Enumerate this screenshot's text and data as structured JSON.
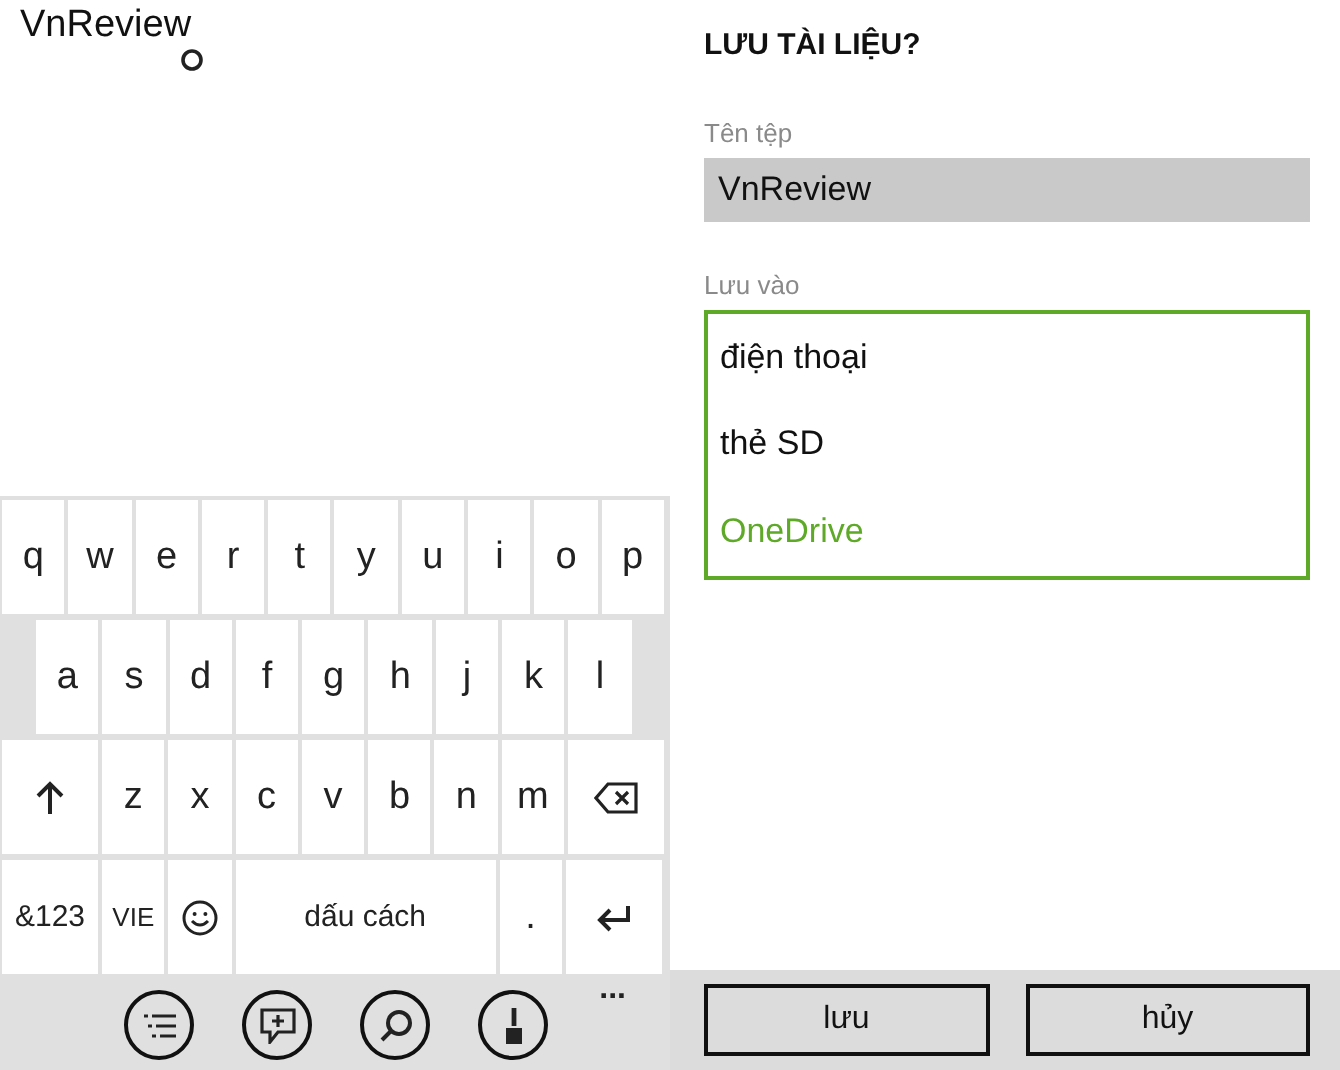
{
  "editor": {
    "text": "VnReview"
  },
  "keyboard": {
    "rows": [
      {
        "keys": [
          {
            "kind": "char",
            "label": "q"
          },
          {
            "kind": "char",
            "label": "w"
          },
          {
            "kind": "char",
            "label": "e"
          },
          {
            "kind": "char",
            "label": "r"
          },
          {
            "kind": "char",
            "label": "t"
          },
          {
            "kind": "char",
            "label": "y"
          },
          {
            "kind": "char",
            "label": "u"
          },
          {
            "kind": "char",
            "label": "i"
          },
          {
            "kind": "char",
            "label": "o"
          },
          {
            "kind": "char",
            "label": "p"
          }
        ]
      },
      {
        "keys": [
          {
            "kind": "char",
            "label": "a"
          },
          {
            "kind": "char",
            "label": "s"
          },
          {
            "kind": "char",
            "label": "d"
          },
          {
            "kind": "char",
            "label": "f"
          },
          {
            "kind": "char",
            "label": "g"
          },
          {
            "kind": "char",
            "label": "h"
          },
          {
            "kind": "char",
            "label": "j"
          },
          {
            "kind": "char",
            "label": "k"
          },
          {
            "kind": "char",
            "label": "l"
          }
        ]
      },
      {
        "keys": [
          {
            "kind": "shift"
          },
          {
            "kind": "char",
            "label": "z"
          },
          {
            "kind": "char",
            "label": "x"
          },
          {
            "kind": "char",
            "label": "c"
          },
          {
            "kind": "char",
            "label": "v"
          },
          {
            "kind": "char",
            "label": "b"
          },
          {
            "kind": "char",
            "label": "n"
          },
          {
            "kind": "char",
            "label": "m"
          },
          {
            "kind": "backspace"
          }
        ]
      },
      {
        "keys": [
          {
            "kind": "wide",
            "label": "&123"
          },
          {
            "kind": "small",
            "label": "VIE"
          },
          {
            "kind": "emoji"
          },
          {
            "kind": "space",
            "label": "dấu cách"
          },
          {
            "kind": "char",
            "label": "."
          },
          {
            "kind": "enter"
          }
        ]
      }
    ],
    "toolbar": [
      {
        "kind": "list"
      },
      {
        "kind": "note"
      },
      {
        "kind": "search"
      },
      {
        "kind": "brush"
      }
    ],
    "more": "..."
  },
  "dialog": {
    "title": "LƯU TÀI LIỆU?",
    "filename_label": "Tên tệp",
    "filename_value": "VnReview",
    "location_label": "Lưu vào",
    "locations": [
      {
        "label": "điện thoại",
        "selected": false
      },
      {
        "label": "thẻ SD",
        "selected": false
      },
      {
        "label": "OneDrive",
        "selected": true
      }
    ],
    "buttons": [
      "lưu",
      "hủy"
    ]
  }
}
